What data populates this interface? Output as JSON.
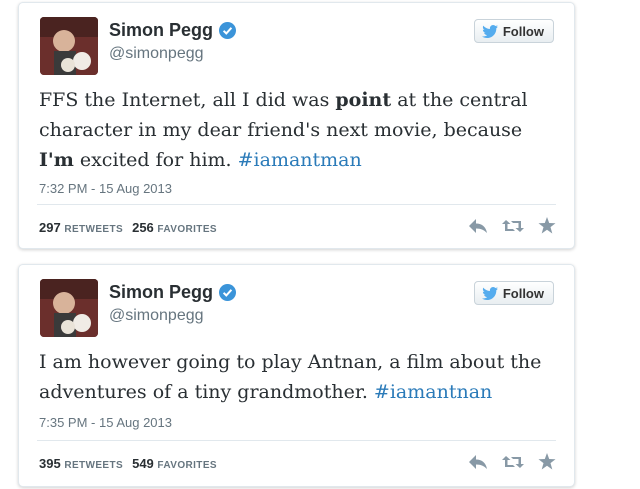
{
  "tweets": [
    {
      "name": "Simon Pegg",
      "handle": "@simonpegg",
      "follow_label": "Follow",
      "text": {
        "t1": "FFS the Internet, all I did was ",
        "b1": "point",
        "t2": " at the central character in my dear friend's next movie, because ",
        "b2": "I'm",
        "t3": " excited for him. ",
        "hashtag": "#iamantman"
      },
      "date": "7:32 PM - 15 Aug 2013",
      "retweets": "297",
      "retweets_label": "RETWEETS",
      "favorites": "256",
      "favorites_label": "FAVORITES"
    },
    {
      "name": "Simon Pegg",
      "handle": "@simonpegg",
      "follow_label": "Follow",
      "text": {
        "t1": "I am however going to play Antnan, a film about the adventures of a tiny grandmother. ",
        "hashtag": "#iamantnan"
      },
      "date": "7:35 PM - 15 Aug 2013",
      "retweets": "395",
      "retweets_label": "RETWEETS",
      "favorites": "549",
      "favorites_label": "FAVORITES"
    }
  ],
  "icons": {
    "verified": "verified-badge-icon",
    "follow": "twitter-bird-icon",
    "reply": "reply-icon",
    "retweet": "retweet-icon",
    "favorite": "star-icon"
  },
  "colors": {
    "hashtag": "#2b7bb9",
    "verified": "#3b94d9",
    "bird": "#55acee",
    "muted": "#66757f",
    "action_icons": "#8899a6"
  }
}
